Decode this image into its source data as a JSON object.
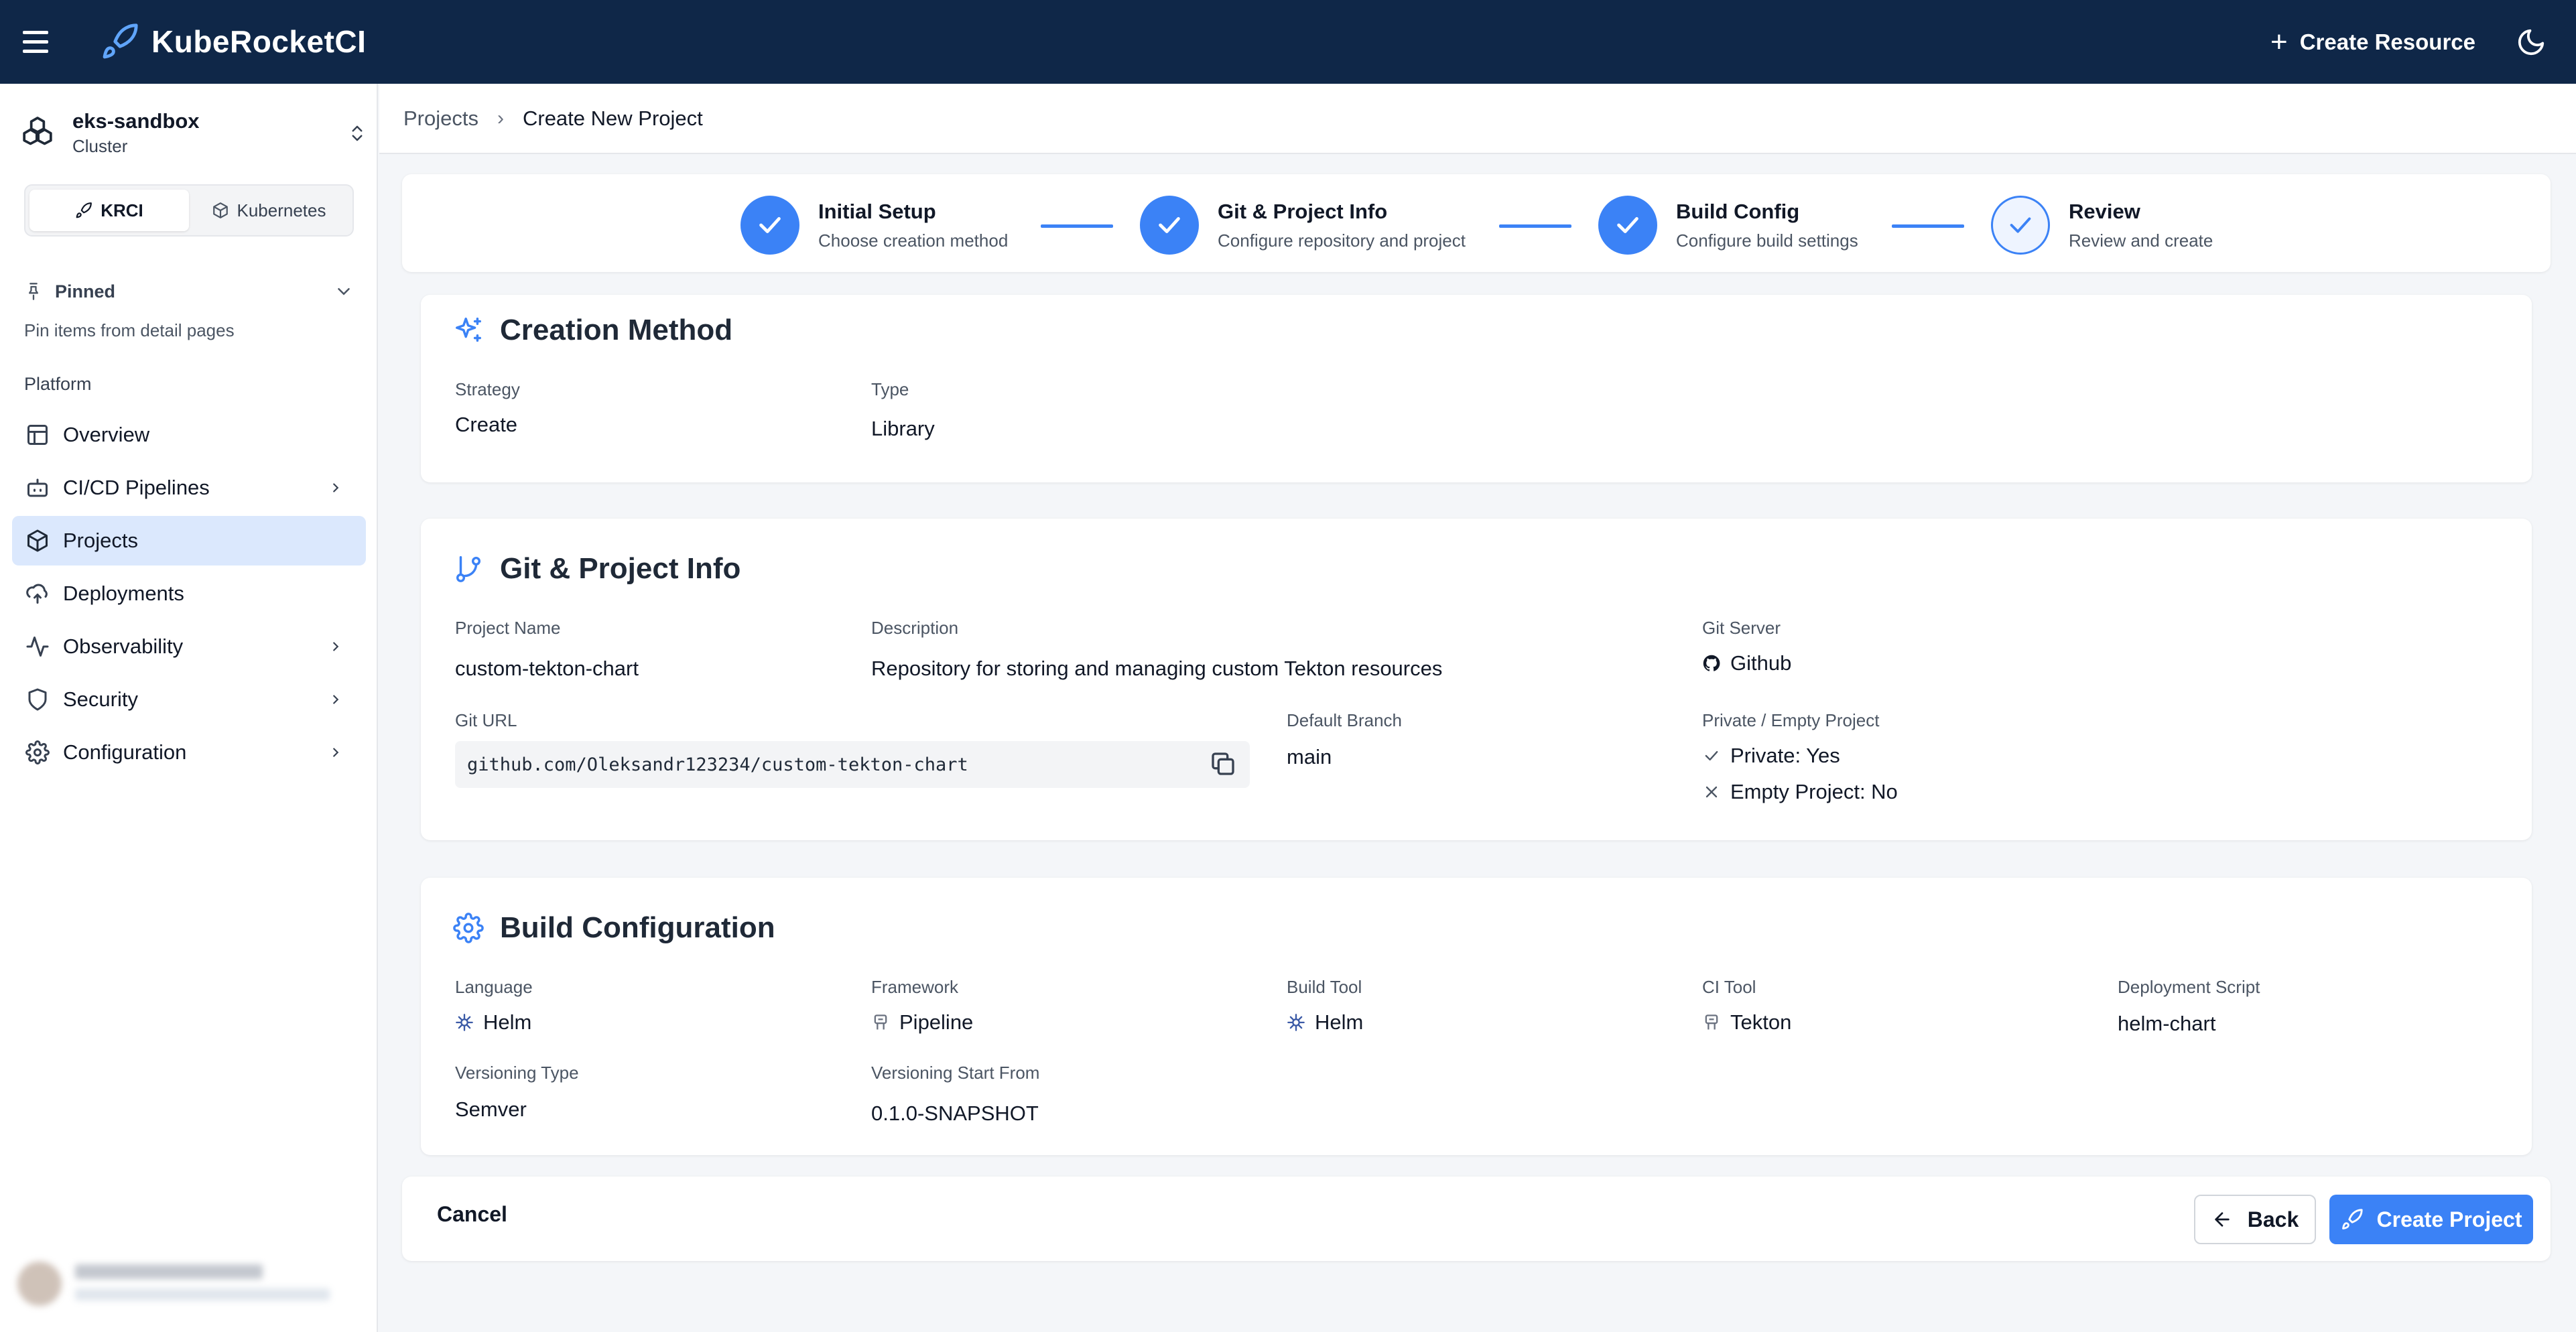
{
  "app": {
    "title": "KubeRocketCI"
  },
  "topbar": {
    "create_resource_label": "Create Resource"
  },
  "cluster": {
    "name": "eks-sandbox",
    "subtitle": "Cluster"
  },
  "switcher": {
    "krci_label": "KRCI",
    "kubernetes_label": "Kubernetes",
    "selected": "KRCI"
  },
  "pinned": {
    "label": "Pinned",
    "hint": "Pin items from detail pages"
  },
  "sidebar": {
    "section_title": "Platform",
    "items": [
      {
        "label": "Overview",
        "icon": "layout-icon",
        "has_children": false,
        "active": false
      },
      {
        "label": "CI/CD Pipelines",
        "icon": "bot-icon",
        "has_children": true,
        "active": false
      },
      {
        "label": "Projects",
        "icon": "box-icon",
        "has_children": false,
        "active": true
      },
      {
        "label": "Deployments",
        "icon": "cloud-upload-icon",
        "has_children": false,
        "active": false
      },
      {
        "label": "Observability",
        "icon": "activity-icon",
        "has_children": true,
        "active": false
      },
      {
        "label": "Security",
        "icon": "shield-icon",
        "has_children": true,
        "active": false
      },
      {
        "label": "Configuration",
        "icon": "gear-icon",
        "has_children": true,
        "active": false
      }
    ]
  },
  "breadcrumb": {
    "parent": "Projects",
    "current": "Create New Project"
  },
  "stepper": {
    "steps": [
      {
        "title": "Initial Setup",
        "subtitle": "Choose creation method",
        "state": "done"
      },
      {
        "title": "Git & Project Info",
        "subtitle": "Configure repository and project",
        "state": "done"
      },
      {
        "title": "Build Config",
        "subtitle": "Configure build settings",
        "state": "done"
      },
      {
        "title": "Review",
        "subtitle": "Review and create",
        "state": "current"
      }
    ]
  },
  "creation_method": {
    "heading": "Creation Method",
    "strategy_label": "Strategy",
    "strategy_value": "Create",
    "type_label": "Type",
    "type_value": "Library"
  },
  "git_info": {
    "heading": "Git & Project Info",
    "project_name_label": "Project Name",
    "project_name_value": "custom-tekton-chart",
    "description_label": "Description",
    "description_value": "Repository for storing and managing custom Tekton resources",
    "git_server_label": "Git Server",
    "git_server_value": "Github",
    "git_url_label": "Git URL",
    "git_url_value": "github.com/Oleksandr123234/custom-tekton-chart",
    "default_branch_label": "Default Branch",
    "default_branch_value": "main",
    "private_empty_label": "Private / Empty Project",
    "private_value": "Private: Yes",
    "empty_value": "Empty Project: No"
  },
  "build_config": {
    "heading": "Build Configuration",
    "language_label": "Language",
    "language_value": "Helm",
    "framework_label": "Framework",
    "framework_value": "Pipeline",
    "build_tool_label": "Build Tool",
    "build_tool_value": "Helm",
    "ci_tool_label": "CI Tool",
    "ci_tool_value": "Tekton",
    "deployment_script_label": "Deployment Script",
    "deployment_script_value": "helm-chart",
    "versioning_type_label": "Versioning Type",
    "versioning_type_value": "Semver",
    "versioning_start_label": "Versioning Start From",
    "versioning_start_value": "0.1.0-SNAPSHOT"
  },
  "footer": {
    "cancel_label": "Cancel",
    "back_label": "Back",
    "create_label": "Create Project"
  },
  "colors": {
    "header_bg": "#0f2748",
    "accent": "#3b82f6",
    "active_nav_bg": "#dbe8fd"
  }
}
